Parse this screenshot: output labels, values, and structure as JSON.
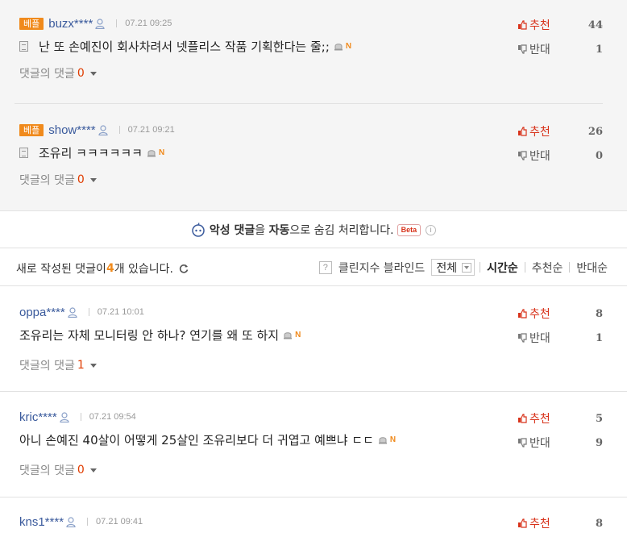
{
  "best_comments": [
    {
      "badge": "베플",
      "nickname": "buzx****",
      "date": "07.21 09:25",
      "text": "난 또 손예진이 회사차려서 넷플리스 작품 기획한다는 줄;;",
      "reply_label": "댓글의 댓글",
      "reply_count": "0",
      "up_label": "추천",
      "up_count": "44",
      "down_label": "반대",
      "down_count": "1"
    },
    {
      "badge": "베플",
      "nickname": "show****",
      "date": "07.21 09:21",
      "text": "조유리 ㅋㅋㅋㅋㅋㅋ",
      "reply_label": "댓글의 댓글",
      "reply_count": "0",
      "up_label": "추천",
      "up_count": "26",
      "down_label": "반대",
      "down_count": "0"
    }
  ],
  "notice": {
    "pre": "악성 댓글",
    "mid1": "을 ",
    "bold2": "자동",
    "post": "으로 숨김 처리합니다.",
    "beta": "Beta",
    "info": "i"
  },
  "toolbar": {
    "new_prefix": "새로 작성된 댓글이 ",
    "new_count": "4",
    "new_suffix": "개 있습니다.",
    "help": "?",
    "clean_label": "클린지수 블라인드",
    "filter_value": "전체",
    "sort_time": "시간순",
    "sort_up": "추천순",
    "sort_down": "반대순"
  },
  "comments": [
    {
      "nickname": "oppa****",
      "date": "07.21 10:01",
      "text": "조유리는 자체 모니터링 안 하나? 연기를 왜 또 하지",
      "reply_label": "댓글의 댓글",
      "reply_count": "1",
      "up_label": "추천",
      "up_count": "8",
      "down_label": "반대",
      "down_count": "1"
    },
    {
      "nickname": "kric****",
      "date": "07.21 09:54",
      "text": "아니 손예진 40살이 어떻게 25살인 조유리보다 더 귀엽고 예쁘냐 ㄷㄷ",
      "reply_label": "댓글의 댓글",
      "reply_count": "0",
      "up_label": "추천",
      "up_count": "5",
      "down_label": "반대",
      "down_count": "9"
    },
    {
      "nickname": "kns1****",
      "date": "07.21 09:41",
      "up_label": "추천",
      "up_count": "8"
    }
  ],
  "colors": {
    "badge": "#f08a1c",
    "nickname": "#3a5a9c",
    "up": "#d8321a",
    "reply_red": "#e03c00"
  }
}
